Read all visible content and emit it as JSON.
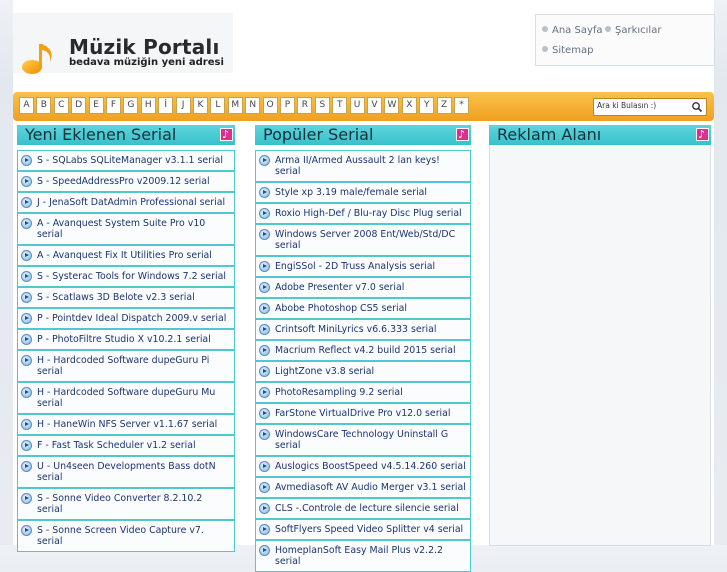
{
  "logo": {
    "title": "Müzik Portalı",
    "subtitle": "bedava müziğin yeni adresi",
    "note_icon": "music-note-icon"
  },
  "topmenu": {
    "home": "Ana Sayfa",
    "singers": "Şarkıcılar",
    "sitemap": "Sitemap"
  },
  "alphabet": [
    "A",
    "B",
    "C",
    "D",
    "E",
    "F",
    "G",
    "H",
    "İ",
    "J",
    "K",
    "L",
    "M",
    "N",
    "O",
    "P",
    "R",
    "S",
    "T",
    "U",
    "V",
    "W",
    "X",
    "Y",
    "Z",
    "*"
  ],
  "search": {
    "placeholder": "Ara ki Bulasın :)",
    "icon": "search-icon"
  },
  "columns": {
    "new": {
      "title": "Yeni Eklenen Serial",
      "items": [
        "S - SQLabs SQLiteManager v3.1.1 serial",
        "S - SpeedAddressPro v2009.12 serial",
        "J - JenaSoft DatAdmin Professional serial",
        "A - Avanquest System Suite Pro v10 serial",
        "A - Avanquest Fix It Utilities Pro serial",
        "S - Systerac Tools for Windows 7.2 serial",
        "S - Scatlaws 3D Belote v2.3 serial",
        "P - Pointdev Ideal Dispatch 2009.v serial",
        "P - PhotoFiltre Studio X v10.2.1 serial",
        "H - Hardcoded Software dupeGuru Pi serial",
        "H - Hardcoded Software dupeGuru Mu serial",
        "H - HaneWin NFS Server v1.1.67 serial",
        "F - Fast Task Scheduler v1.2 serial",
        "U - Un4seen Developments Bass dotN serial",
        "S - Sonne Video Converter 8.2.10.2 serial",
        "S - Sonne Screen Video Capture v7. serial"
      ]
    },
    "popular": {
      "title": "Popüler Serial",
      "items": [
        "Arma II/Armed Aussault 2 lan keys! serial",
        "Style xp 3.19 male/female serial",
        "Roxio High-Def / Blu-ray Disc Plug serial",
        "Windows Server 2008 Ent/Web/Std/DC serial",
        "EngiSSol - 2D Truss Analysis serial",
        "Adobe Presenter v7.0 serial",
        "Abobe Photoshop CS5 serial",
        "Crintsoft MiniLyrics v6.6.333 serial",
        "Macrium Reflect v4.2 build 2015 serial",
        "LightZone v3.8 serial",
        "PhotoResampling 9.2 serial",
        "FarStone VirtualDrive Pro v12.0 serial",
        "WindowsCare Technology Uninstall G serial",
        "Auslogics BoostSpeed v4.5.14.260 serial",
        "Avmediasoft AV Audio Merger v3.1 serial",
        "CLS -.Controle de lecture silencie serial",
        "SoftFlyers Speed Video Splitter v4 serial",
        "HomeplanSoft Easy Mail Plus v2.2.2 serial"
      ]
    },
    "ads": {
      "title": "Reklam Alanı"
    }
  },
  "colors": {
    "accent_bar": "#f0a020",
    "column_head": "#38c1ca",
    "item_border": "#4fc8d0",
    "link_text": "#1b3570",
    "music_icon": "#d8318f"
  }
}
